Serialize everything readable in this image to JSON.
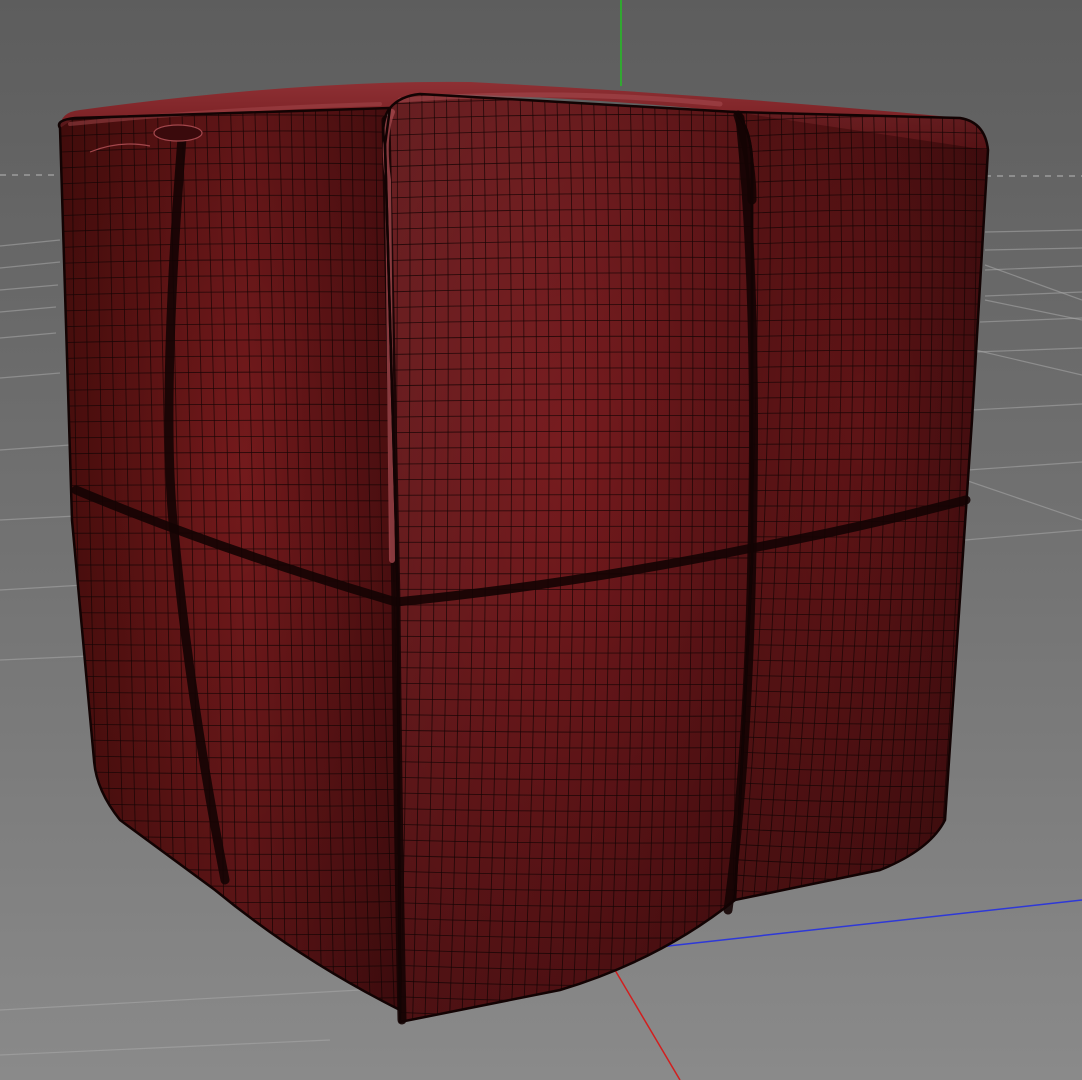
{
  "viewport": {
    "background_top": "#5f5f5f",
    "background_bottom": "#858585",
    "grid_color": "#a9a9a9",
    "horizon_color": "#b8b8b8"
  },
  "axes": {
    "x_color": "#d21e1e",
    "y_color": "#22c022",
    "z_color": "#2e38d8"
  },
  "object": {
    "type": "subdivided-cube",
    "base_color": "#6e1518",
    "shadow_color": "#3a0a0c",
    "highlight_color": "#a3474c",
    "wire_color": "#1a0506",
    "seam_color": "#140303"
  }
}
